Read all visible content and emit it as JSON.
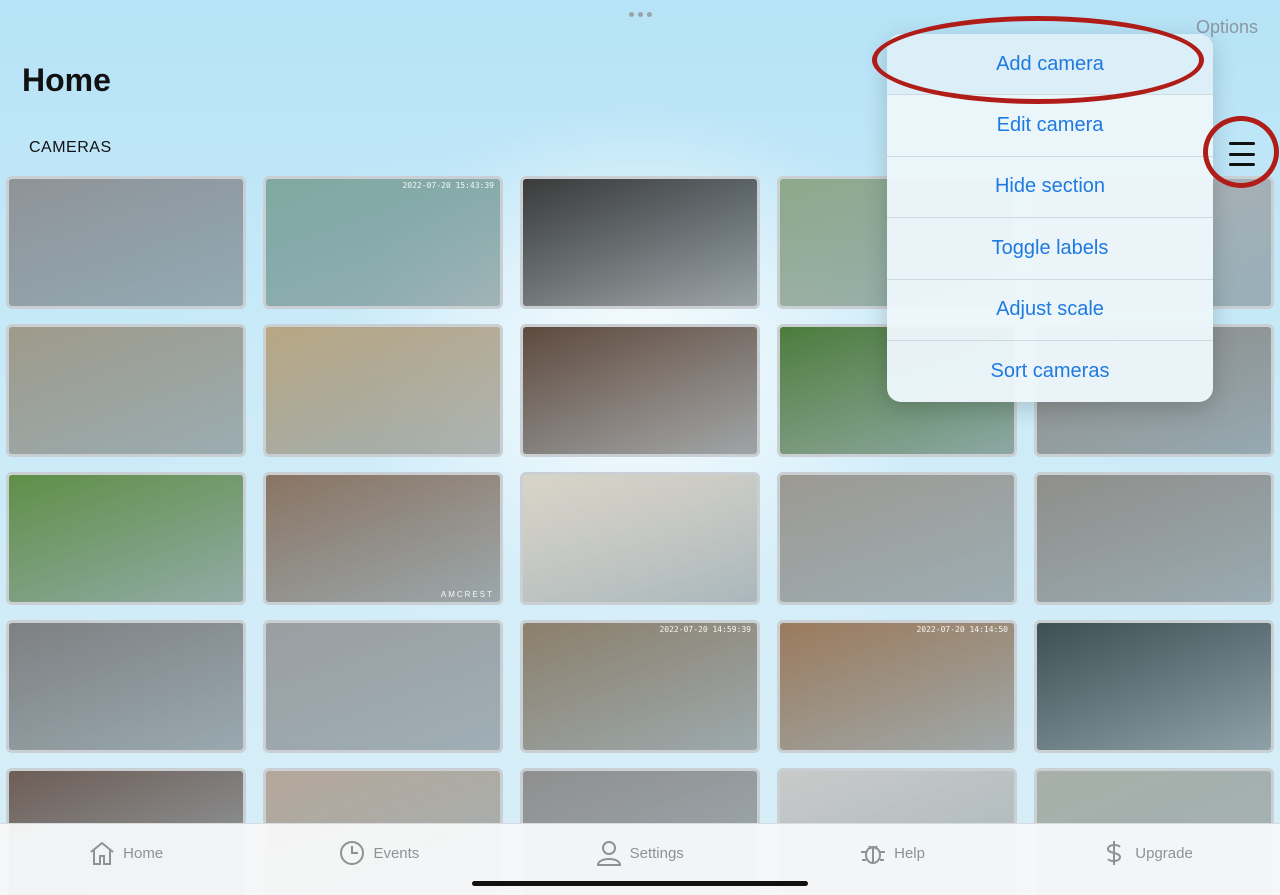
{
  "header": {
    "title": "Home",
    "options_label": "Options",
    "section_label": "CAMERAS"
  },
  "menu": {
    "items": [
      {
        "label": "Add camera"
      },
      {
        "label": "Edit camera"
      },
      {
        "label": "Hide section"
      },
      {
        "label": "Toggle labels"
      },
      {
        "label": "Adjust scale"
      },
      {
        "label": "Sort cameras"
      }
    ]
  },
  "cameras": [
    {
      "bg": "#8f9398",
      "ts": "",
      "brand": ""
    },
    {
      "bg": "#7fa9a2",
      "ts": "2022-07-20 15:43:39",
      "brand": ""
    },
    {
      "bg": "#3b3b3b",
      "ts": "",
      "brand": ""
    },
    {
      "bg": "#8da98a",
      "ts": "",
      "brand": ""
    },
    {
      "bg": "#aeb2b4",
      "ts": "",
      "brand": ""
    },
    {
      "bg": "#9f9a8a",
      "ts": "",
      "brand": ""
    },
    {
      "bg": "#b9a683",
      "ts": "",
      "brand": ""
    },
    {
      "bg": "#5e4a3e",
      "ts": "",
      "brand": ""
    },
    {
      "bg": "#4b7c3c",
      "ts": "",
      "brand": ""
    },
    {
      "bg": "#8c8a86",
      "ts": "",
      "brand": ""
    },
    {
      "bg": "#5f8f47",
      "ts": "",
      "brand": ""
    },
    {
      "bg": "#8a7463",
      "ts": "",
      "brand": "AMCREST"
    },
    {
      "bg": "#d9d4c8",
      "ts": "",
      "brand": ""
    },
    {
      "bg": "#9b9992",
      "ts": "",
      "brand": ""
    },
    {
      "bg": "#8f8e8a",
      "ts": "",
      "brand": ""
    },
    {
      "bg": "#7e8082",
      "ts": "",
      "brand": ""
    },
    {
      "bg": "#9a9ea1",
      "ts": "",
      "brand": ""
    },
    {
      "bg": "#8b7f6b",
      "ts": "2022-07-20 14:59:39",
      "brand": ""
    },
    {
      "bg": "#9b7a5c",
      "ts": "2022-07-20 14:14:50",
      "brand": ""
    },
    {
      "bg": "#3d4f52",
      "ts": "",
      "brand": ""
    },
    {
      "bg": "#6d5d56",
      "ts": "",
      "brand": ""
    },
    {
      "bg": "#b4a79a",
      "ts": "",
      "brand": ""
    },
    {
      "bg": "#8f8f8f",
      "ts": "",
      "brand": ""
    },
    {
      "bg": "#c9cac9",
      "ts": "",
      "brand": ""
    },
    {
      "bg": "#a7b0a8",
      "ts": "",
      "brand": ""
    }
  ],
  "tabs": [
    {
      "label": "Home",
      "icon": "home-icon"
    },
    {
      "label": "Events",
      "icon": "clock-icon"
    },
    {
      "label": "Settings",
      "icon": "person-icon"
    },
    {
      "label": "Help",
      "icon": "bug-icon"
    },
    {
      "label": "Upgrade",
      "icon": "dollar-icon"
    }
  ],
  "colors": {
    "accent": "#1f7ae0",
    "annotation": "#b01d18"
  }
}
